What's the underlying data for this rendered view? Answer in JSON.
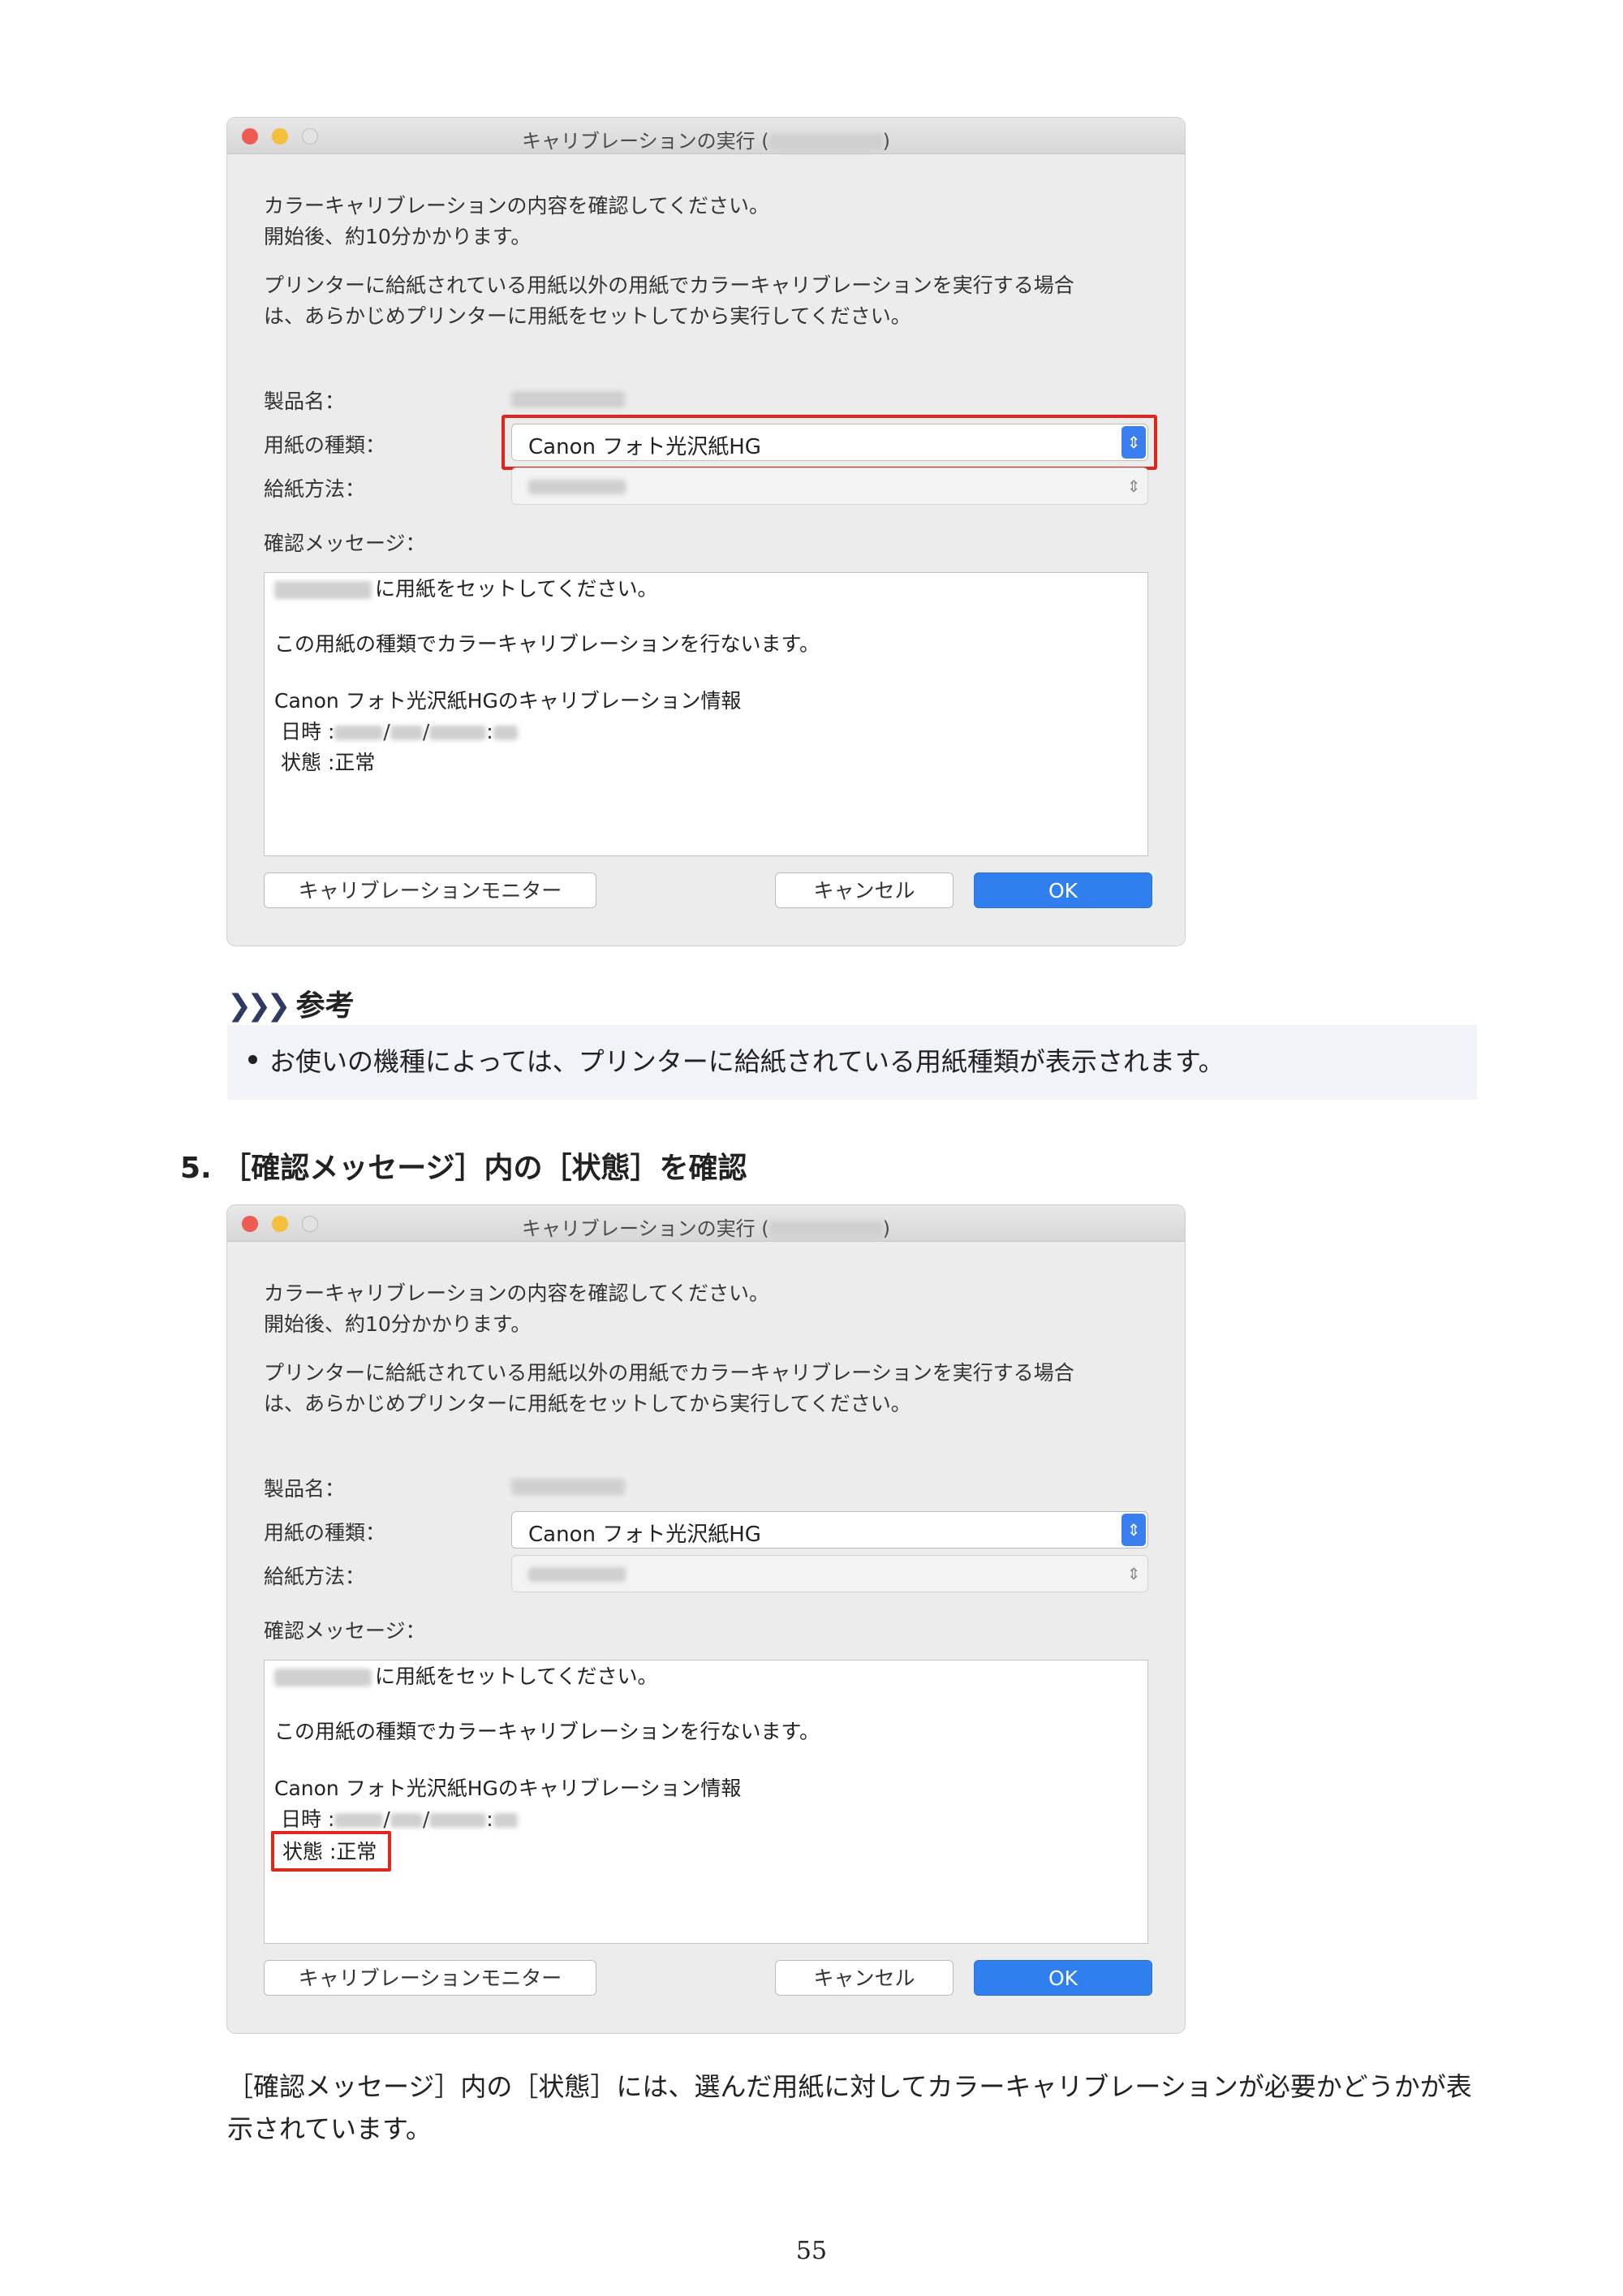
{
  "dialog": {
    "title": "キャリブレーションの実行 (",
    "title_end": ")",
    "intro_line1": "カラーキャリブレーションの内容を確認してください。",
    "intro_line2": "開始後、約10分かかります。",
    "intro_line3": "プリンターに給紙されている用紙以外の用紙でカラーキャリブレーションを実行する場合",
    "intro_line4": "は、あらかじめプリンターに用紙をセットしてから実行してください。",
    "label_product": "製品名：",
    "label_media_type": "用紙の種類：",
    "label_paper_source": "給紙方法：",
    "label_confirm_message": "確認メッセージ：",
    "media_type_value": "Canon フォト光沢紙HG",
    "message": {
      "line1": "に用紙をセットしてください。",
      "line2": "この用紙の種類でカラーキャリブレーションを行ないます。",
      "line3": "Canon フォト光沢紙HGのキャリブレーション情報",
      "date_label": "日時 :",
      "date_sep1": "/",
      "date_sep2": "/",
      "time_sep": ":",
      "status": "状態 :正常"
    },
    "btn_monitor": "キャリブレーションモニター",
    "btn_cancel": "キャンセル",
    "btn_ok": "OK"
  },
  "note": {
    "arrows": "❯❯❯",
    "heading": "参考",
    "bullet": "お使いの機種によっては、プリンターに給紙されている用紙種類が表示されます。"
  },
  "step5": "5. ［確認メッセージ］内の［状態］を確認",
  "paragraph": "［確認メッセージ］内の［状態］には、選んだ用紙に対してカラーキャリブレーションが必要かどうかが表示されています。",
  "page_number": "55",
  "colors": {
    "highlight": "#e3261d",
    "ok_button": "#2f80ee",
    "note_bg": "#f1f3f8"
  }
}
